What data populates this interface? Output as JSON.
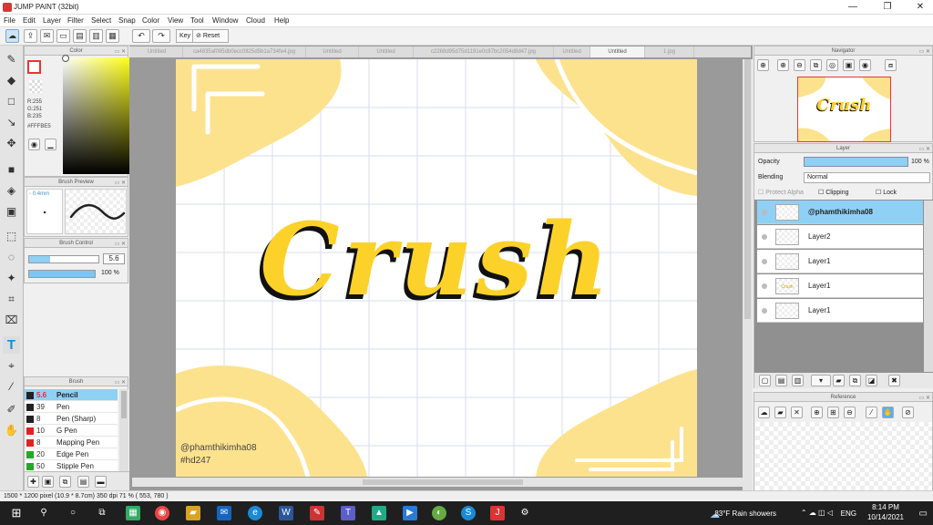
{
  "app": {
    "title": "JUMP PAINT (32bit)"
  },
  "window": {
    "minimize": "—",
    "maximize": "❐",
    "close": "✕"
  },
  "menu": [
    "File",
    "Edit",
    "Layer",
    "Filter",
    "Select",
    "Snap",
    "Color",
    "View",
    "Tool",
    "Window",
    "Cloud",
    "Help"
  ],
  "toolbar": {
    "key_label": "Key",
    "reset_label": "Reset"
  },
  "panels": {
    "color": "Color",
    "brush_preview": "Brush Preview",
    "brush_control": "Brush Control",
    "brush": "Brush",
    "navigator": "Navigator",
    "layer": "Layer",
    "reference": "Reference"
  },
  "color": {
    "r": "R:255",
    "g": "G:251",
    "b": "B:235",
    "hex": "#FFFBE5"
  },
  "brush_preview": {
    "size_label": "0.4mm"
  },
  "brush_control": {
    "size": "5.6",
    "opacity": "100 %",
    "size_fraction": 0.3,
    "opacity_fraction": 1.0
  },
  "brushes": [
    {
      "color": "#222222",
      "size": "5.6",
      "name": "Pencil"
    },
    {
      "color": "#222222",
      "size": "39",
      "name": "Pen"
    },
    {
      "color": "#222222",
      "size": "8",
      "name": "Pen (Sharp)"
    },
    {
      "color": "#e22222",
      "size": "10",
      "name": "G Pen"
    },
    {
      "color": "#e22222",
      "size": "8",
      "name": "Mapping Pen"
    },
    {
      "color": "#22aa22",
      "size": "20",
      "name": "Edge Pen"
    },
    {
      "color": "#22aa22",
      "size": "50",
      "name": "Stipple Pen"
    }
  ],
  "tabs": [
    "Untitled",
    "ca4835af095db0ecc0825d5b1a734fe4.jpg",
    "Untitled",
    "Untitled",
    "c2268d95d75d1191e0c87bc2054d8d47.jpg",
    "Untitled",
    "Untitled",
    "1.jpg"
  ],
  "artwork": {
    "title": "Crush",
    "credit": "@phamthikimha08",
    "hashtag": "#hd247",
    "nav_title": "Crush"
  },
  "layer": {
    "opacity_label": "Opacity",
    "opacity": "100 %",
    "blending_label": "Blending",
    "blending": "Normal",
    "protect_alpha": "Protect Alpha",
    "clipping": "Clipping",
    "lock": "Lock"
  },
  "layers": [
    "@phamthikimha08",
    "Layer2",
    "Layer1",
    "Layer1",
    "Layer1"
  ],
  "layer_thumbs": [
    "",
    "",
    "",
    "Crush",
    ""
  ],
  "status": {
    "info": "1500 * 1200 pixel  (10.9 * 8.7cm)  350 dpi  71 %  ( 553, 780 )"
  },
  "taskbar": {
    "weather": "83°F  Rain showers",
    "lang": "ENG",
    "time": "8:14 PM",
    "date": "10/14/2021"
  },
  "colors": {
    "accent": "#8fd0f5",
    "yellow": "#fde28e",
    "letter": "#fcd22a"
  }
}
